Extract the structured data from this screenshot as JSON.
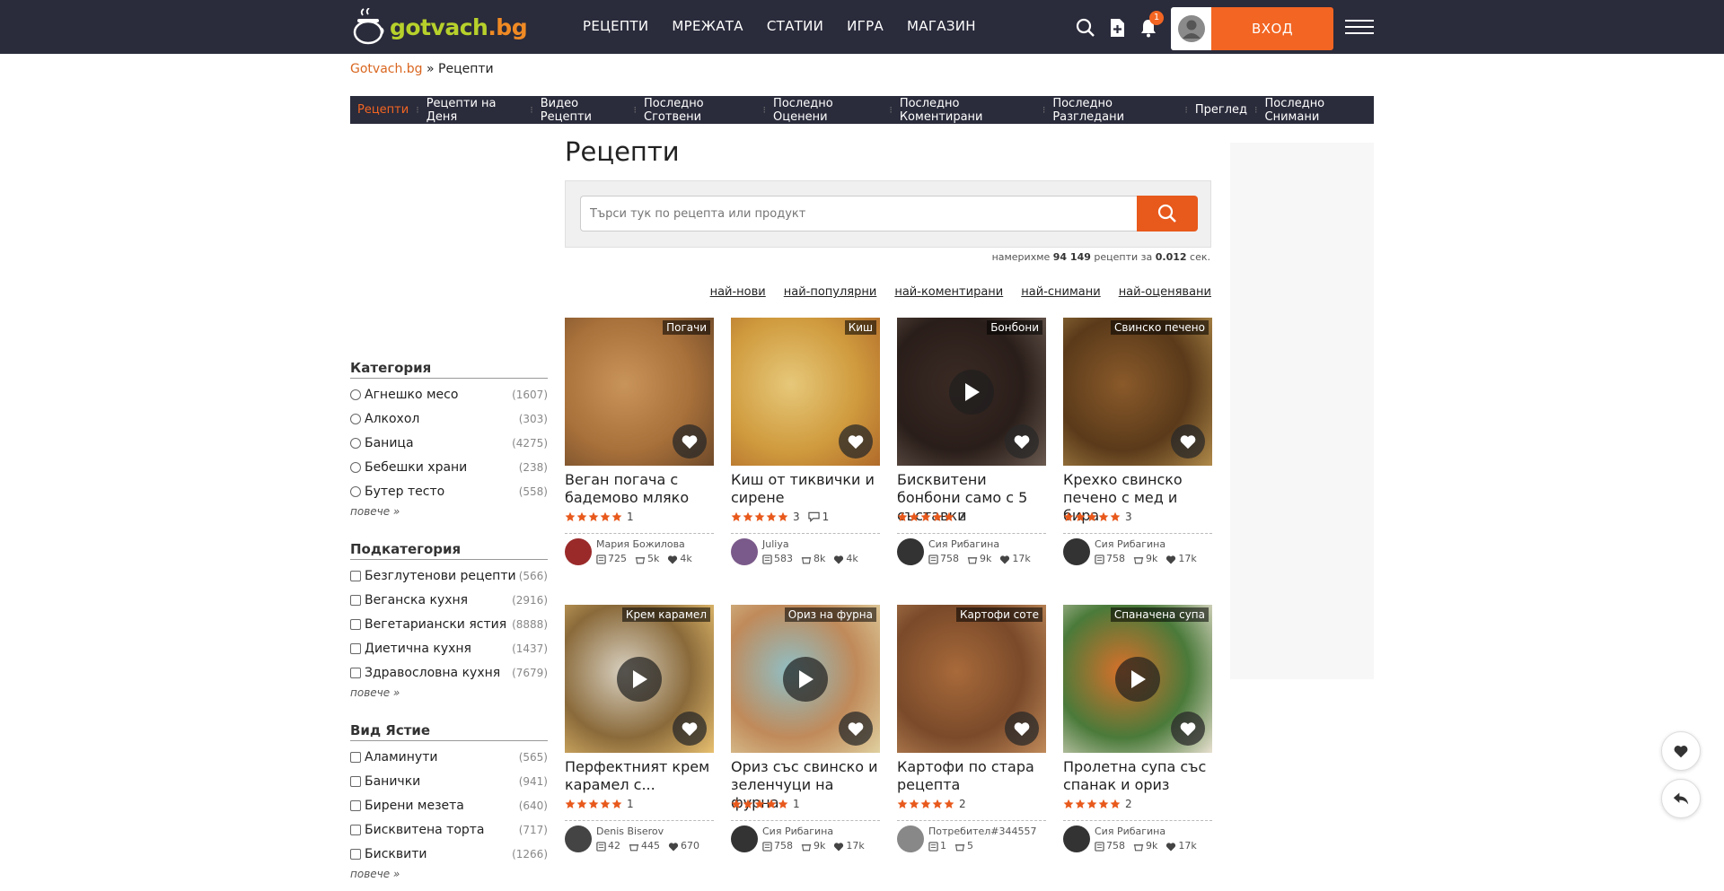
{
  "header": {
    "logo_main": "gotvach",
    "logo_tld": ".bg",
    "nav": [
      "РЕЦЕПТИ",
      "МРЕЖАТА",
      "СТАТИИ",
      "ИГРА",
      "МАГАЗИН"
    ],
    "notifications_count": "1",
    "login_label": "ВХОД"
  },
  "breadcrumb": {
    "home": "Gotvach.bg",
    "sep": " » ",
    "current": "Рецепти"
  },
  "subnav": [
    "Рецепти",
    "Рецепти на Деня",
    "Видео Рецепти",
    "Последно Сготвени",
    "Последно Оценени",
    "Последно Коментирани",
    "Последно Разгледани",
    "Преглед",
    "Последно Снимани"
  ],
  "main": {
    "title": "Рецепти",
    "search_placeholder": "Търси тук по рецепта или продукт",
    "results_prefix": "намерихме",
    "results_count": "94 149",
    "results_mid": "рецепти за",
    "results_time": "0.012",
    "results_suffix": "сек.",
    "sort": [
      "най-нови",
      "най-популярни",
      "най-коментирани",
      "най-снимани",
      "най-оценявани"
    ]
  },
  "filters": {
    "category": {
      "title": "Категория",
      "items": [
        {
          "label": "Агнешко месо",
          "count": "(1607)"
        },
        {
          "label": "Алкохол",
          "count": "(303)"
        },
        {
          "label": "Баница",
          "count": "(4275)"
        },
        {
          "label": "Бебешки храни",
          "count": "(238)"
        },
        {
          "label": "Бутер тесто",
          "count": "(558)"
        }
      ],
      "more": "повече »"
    },
    "subcategory": {
      "title": "Подкатегория",
      "items": [
        {
          "label": "Безглутенови рецепти",
          "count": "(566)"
        },
        {
          "label": "Веганска кухня",
          "count": "(2916)"
        },
        {
          "label": "Вегетариански ястия",
          "count": "(8888)"
        },
        {
          "label": "Диетична кухня",
          "count": "(1437)"
        },
        {
          "label": "Здравословна кухня",
          "count": "(7679)"
        }
      ],
      "more": "повече »"
    },
    "dish_type": {
      "title": "Вид Ястие",
      "items": [
        {
          "label": "Аламинути",
          "count": "(565)"
        },
        {
          "label": "Банички",
          "count": "(941)"
        },
        {
          "label": "Бирени мезета",
          "count": "(640)"
        },
        {
          "label": "Бисквитена торта",
          "count": "(717)"
        },
        {
          "label": "Бисквити",
          "count": "(1266)"
        }
      ],
      "more": "повече »"
    }
  },
  "recipes": [
    {
      "tag": "Погачи",
      "title": "Веган погача с бадемово мляко",
      "rating_count": "1",
      "comments": "",
      "author": "Мария Божилова",
      "recipes": "725",
      "cooked": "5k",
      "likes": "4k",
      "video": false,
      "img_colors": [
        "#c9945a",
        "#a8703a",
        "#6e4a2a"
      ],
      "avatar_color": "#9a2a2a"
    },
    {
      "tag": "Киш",
      "title": "Киш от тиквички и сирене",
      "rating_count": "3",
      "comments": "1",
      "author": "Juliya",
      "recipes": "583",
      "cooked": "8k",
      "likes": "4k",
      "video": false,
      "img_colors": [
        "#e6c87a",
        "#d09b3e",
        "#b06a2a"
      ],
      "avatar_color": "#7a5a8a"
    },
    {
      "tag": "Бонбони",
      "title": "Бисквитени бонбони само с 5 съставки",
      "rating_count": "2",
      "comments": "",
      "author": "Сия Рибагина",
      "recipes": "758",
      "cooked": "9k",
      "likes": "17k",
      "video": true,
      "img_colors": [
        "#3a2a24",
        "#2a1e1a",
        "#6a5a50"
      ],
      "avatar_color": "#333333"
    },
    {
      "tag": "Свинско печено",
      "title": "Крехко свинско печено с мед и бира",
      "rating_count": "3",
      "comments": "",
      "author": "Сия Рибагина",
      "recipes": "758",
      "cooked": "9k",
      "likes": "17k",
      "video": false,
      "img_colors": [
        "#8a5a2a",
        "#5a3a1a",
        "#b08a4a"
      ],
      "avatar_color": "#333333"
    },
    {
      "tag": "Крем карамел",
      "title": "Перфектният крем карамел с...",
      "rating_count": "1",
      "comments": "",
      "author": "Denis Biserov",
      "recipes": "42",
      "cooked": "445",
      "likes": "670",
      "video": true,
      "img_colors": [
        "#d8d0c0",
        "#8a6a3a",
        "#e8c070"
      ],
      "avatar_color": "#444444"
    },
    {
      "tag": "Ориз на фурна",
      "title": "Ориз със свинско и зеленчуци на фурна",
      "rating_count": "1",
      "comments": "",
      "author": "Сия Рибагина",
      "recipes": "758",
      "cooked": "9k",
      "likes": "17k",
      "video": true,
      "img_colors": [
        "#8fbfc6",
        "#c08a5a",
        "#e0d0a0"
      ],
      "avatar_color": "#333333"
    },
    {
      "tag": "Картофи соте",
      "title": "Картофи по стара рецепта",
      "rating_count": "2",
      "comments": "",
      "author": "Потребител#344557",
      "recipes": "1",
      "cooked": "5",
      "likes": "",
      "video": false,
      "img_colors": [
        "#a86a3a",
        "#7a4a2a",
        "#c08a5a"
      ],
      "avatar_color": "#888888"
    },
    {
      "tag": "Спаначена супа",
      "title": "Пролетна супа със спанак и ориз",
      "rating_count": "2",
      "comments": "",
      "author": "Сия Рибагина",
      "recipes": "758",
      "cooked": "9k",
      "likes": "17k",
      "video": true,
      "img_colors": [
        "#d8702a",
        "#4a7a3a",
        "#e8e0d0"
      ],
      "avatar_color": "#333333"
    }
  ],
  "colors": {
    "header_bg": "#2a2b3b",
    "accent": "#f26522",
    "link_accent": "#d9661f",
    "star": "#e8591c"
  }
}
